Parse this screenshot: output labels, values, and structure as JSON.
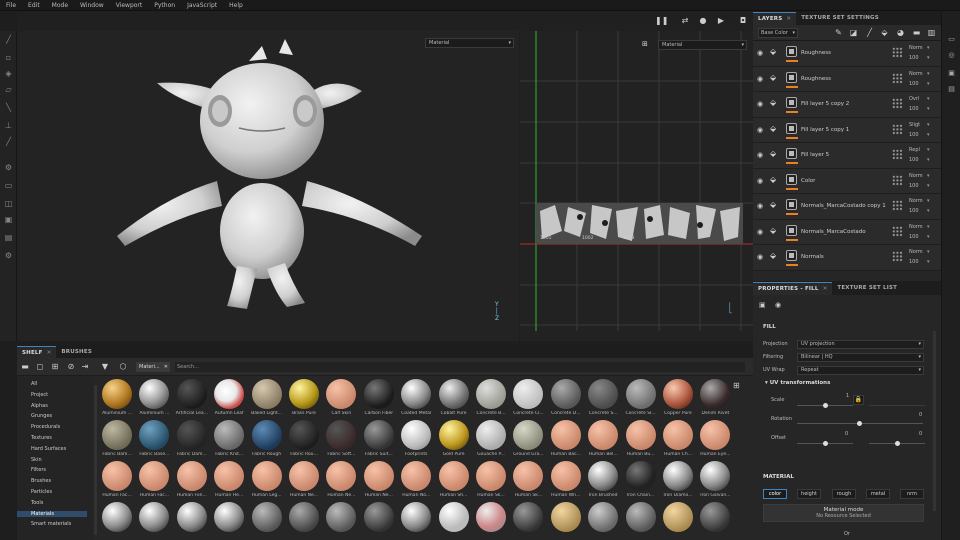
{
  "menu": [
    "File",
    "Edit",
    "Mode",
    "Window",
    "Viewport",
    "Python",
    "JavaScript",
    "Help"
  ],
  "viewport": {
    "left_mode": "Material",
    "right_mode": "Material"
  },
  "uv_labels": [
    "1001",
    "1002",
    "1003"
  ],
  "layers_panel": {
    "tabs": [
      "LAYERS",
      "TEXTURE SET SETTINGS"
    ],
    "channel": "Base Color",
    "layers": [
      {
        "name": "Roughness",
        "blend": "Norm",
        "opacity": "100"
      },
      {
        "name": "Roughness",
        "blend": "Norm",
        "opacity": "100"
      },
      {
        "name": "Fill layer 5 copy 2",
        "blend": "Ovrl",
        "opacity": "100"
      },
      {
        "name": "Fill layer 5 copy 1",
        "blend": "Sligt",
        "opacity": "100"
      },
      {
        "name": "Fill layer 5",
        "blend": "Repl",
        "opacity": "100"
      },
      {
        "name": "Color",
        "blend": "Norm",
        "opacity": "100"
      },
      {
        "name": "Normals_MarcaCostado copy 1",
        "blend": "Norm",
        "opacity": "100"
      },
      {
        "name": "Normals_MarcaCostado",
        "blend": "Norm",
        "opacity": "100"
      },
      {
        "name": "Normals",
        "blend": "Norm",
        "opacity": "100"
      }
    ]
  },
  "properties": {
    "tabs": [
      "PROPERTIES - FILL",
      "TEXTURE SET LIST"
    ],
    "fill_title": "FILL",
    "projection_label": "Projection",
    "projection": "UV projection",
    "filtering_label": "Filtering",
    "filtering": "Bilinear | HQ",
    "uvwrap_label": "UV Wrap",
    "uvwrap": "Repeat",
    "uv_transforms": "UV transformations",
    "scale_label": "Scale",
    "scale_value": "1",
    "rotation_label": "Rotation",
    "rotation_value": "0",
    "offset_label": "Offset",
    "offset_x": "0",
    "offset_y": "0",
    "material_title": "MATERIAL",
    "channels": [
      "color",
      "height",
      "rough",
      "metal",
      "nrm"
    ],
    "material_mode": "Material mode",
    "no_resource": "No Resource Selected",
    "or": "Or"
  },
  "shelf": {
    "tabs": [
      "SHELF",
      "BRUSHES"
    ],
    "filter": "Materi...",
    "search_placeholder": "Search...",
    "categories": [
      "All",
      "Project",
      "Alphas",
      "Grunges",
      "Procedurals",
      "Textures",
      "Hard Surfaces",
      "Skin",
      "Filters",
      "Brushes",
      "Particles",
      "Tools",
      "Materials",
      "Smart materials"
    ],
    "active_category": "Materials",
    "row1": [
      "Aluminium ...",
      "Aluminium ...",
      "Artificial Lea...",
      "Autumn Leaf",
      "Baked Light...",
      "Brass Pure",
      "Calf Skin",
      "Carbon Fiber",
      "Coated Metal",
      "Cobalt Pure",
      "Concrete B...",
      "Concrete Cl...",
      "Concrete D...",
      "Concrete S...",
      "Concrete Sl...",
      "Copper Pure",
      "Denim Rivet"
    ],
    "row2": [
      "Fabric Bam...",
      "Fabric Base...",
      "Fabric Dam...",
      "Fabric Knit...",
      "Fabric Rough",
      "Fabric Rou...",
      "Fabric Soft...",
      "Fabric Suit...",
      "Footprints",
      "Gold Pure",
      "Gouache P...",
      "Ground Gra...",
      "Human Bac...",
      "Human Bel...",
      "Human Bu...",
      "Human Ch...",
      "Human Eye..."
    ],
    "row3": [
      "Human Fac...",
      "Human Fac...",
      "Human Fon...",
      "Human He...",
      "Human Leg...",
      "Human Ne...",
      "Human Ne...",
      "Human Ne...",
      "Human No...",
      "Human Sh...",
      "Human Sk...",
      "Human Sk...",
      "Human Wri...",
      "Iron Brushed",
      "Iron Chain...",
      "Iron Diamo...",
      "Iron Galvan..."
    ],
    "row4": [
      "",
      "",
      "",
      "",
      "",
      "",
      "",
      "",
      "",
      "",
      "",
      "",
      "",
      "",
      "",
      "",
      ""
    ]
  },
  "colors": {
    "accent": "#3d86c6",
    "layer_bar": "#e8821e"
  }
}
